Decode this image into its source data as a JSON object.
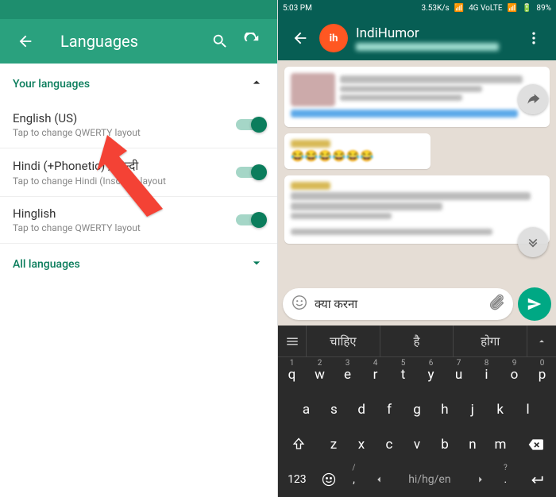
{
  "left": {
    "title": "Languages",
    "section_your": "Your languages",
    "section_all": "All languages",
    "items": [
      {
        "name": "English (US)",
        "sub": "Tap to change QWERTY layout"
      },
      {
        "name": "Hindi (+Phonetic) / हिन्दी",
        "sub": "Tap to change Hindi (Inscript) layout"
      },
      {
        "name": "Hinglish",
        "sub": "Tap to change QWERTY layout"
      }
    ]
  },
  "right": {
    "status": {
      "time": "5:03 PM",
      "net": "3.53K/s",
      "sig": "4G VoLTE",
      "batt": "89%"
    },
    "chat_title": "IndiHumor",
    "input_text": "क्या करना",
    "suggestions": [
      "चाहिए",
      "है",
      "होगा"
    ],
    "keyboard": {
      "row_num": [
        "1",
        "2",
        "3",
        "4",
        "5",
        "6",
        "7",
        "8",
        "9",
        "0"
      ],
      "row_q": [
        "q",
        "w",
        "e",
        "r",
        "t",
        "y",
        "u",
        "i",
        "o",
        "p"
      ],
      "row_a": [
        "a",
        "s",
        "d",
        "f",
        "g",
        "h",
        "j",
        "k",
        "l"
      ],
      "row_z": [
        "z",
        "x",
        "c",
        "v",
        "b",
        "n",
        "m"
      ],
      "mode": "123",
      "space": "hi/hg/en",
      "comma": ",",
      "period": ".",
      "slash": "/",
      "qmark": "?"
    }
  }
}
